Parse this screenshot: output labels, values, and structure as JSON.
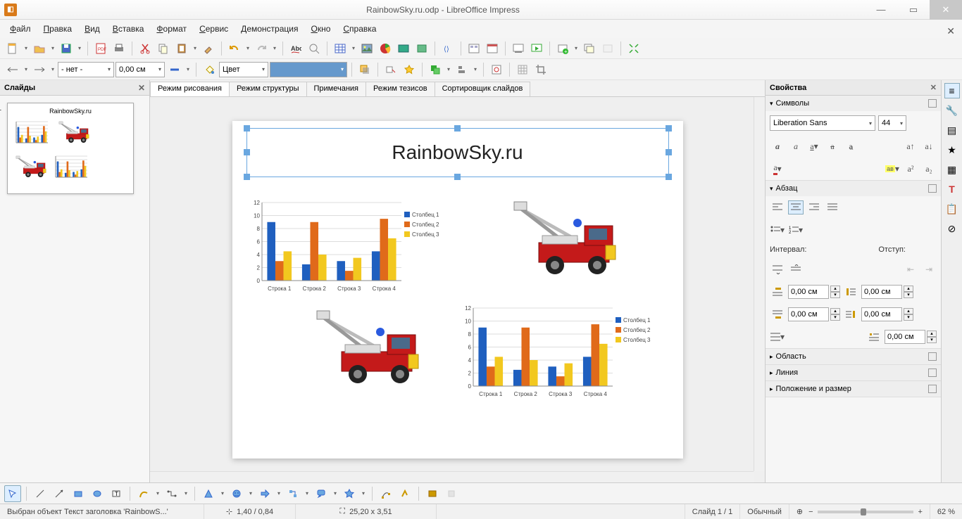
{
  "window": {
    "title": "RainbowSky.ru.odp - LibreOffice Impress"
  },
  "menu": [
    "Файл",
    "Правка",
    "Вид",
    "Вставка",
    "Формат",
    "Сервис",
    "Демонстрация",
    "Окно",
    "Справка"
  ],
  "toolbar2": {
    "line_style": "- нет -",
    "line_width": "0,00 см",
    "fill_label": "Цвет"
  },
  "slidepanel": {
    "title": "Слайды",
    "thumb_title": "RainbowSky.ru",
    "slide_number": "1"
  },
  "view_tabs": [
    "Режим рисования",
    "Режим структуры",
    "Примечания",
    "Режим тезисов",
    "Сортировщик слайдов"
  ],
  "slide_title": "RainbowSky.ru",
  "sidebar": {
    "title": "Свойства",
    "s_symbols": "Символы",
    "s_para": "Абзац",
    "s_area": "Область",
    "s_line": "Линия",
    "s_pos": "Положение и размер",
    "font_name": "Liberation Sans",
    "font_size": "44",
    "interval_label": "Интервал:",
    "indent_label": "Отступ:",
    "spacing_value": "0,00 см"
  },
  "status": {
    "selection": "Выбран объект Текст заголовка 'RainbowS...'",
    "pos": "1,40 / 0,84",
    "size": "25,20 x 3,51",
    "slide": "Слайд 1 / 1",
    "master": "Обычный",
    "zoom": "62 %"
  },
  "chart_data": {
    "type": "bar",
    "categories": [
      "Строка 1",
      "Строка 2",
      "Строка 3",
      "Строка 4"
    ],
    "series": [
      {
        "name": "Столбец 1",
        "values": [
          9.0,
          2.5,
          3.0,
          4.5
        ],
        "color": "#1f5fbf"
      },
      {
        "name": "Столбец 2",
        "values": [
          3.0,
          9.0,
          1.5,
          9.5
        ],
        "color": "#e06a1a"
      },
      {
        "name": "Столбец 3",
        "values": [
          4.5,
          4.0,
          3.5,
          6.5
        ],
        "color": "#f2c81f"
      }
    ],
    "ylim": [
      0,
      12
    ],
    "yticks": [
      0,
      2,
      4,
      6,
      8,
      10,
      12
    ],
    "legend": [
      "Столбец 1",
      "Столбец 2",
      "Столбец 3"
    ]
  }
}
